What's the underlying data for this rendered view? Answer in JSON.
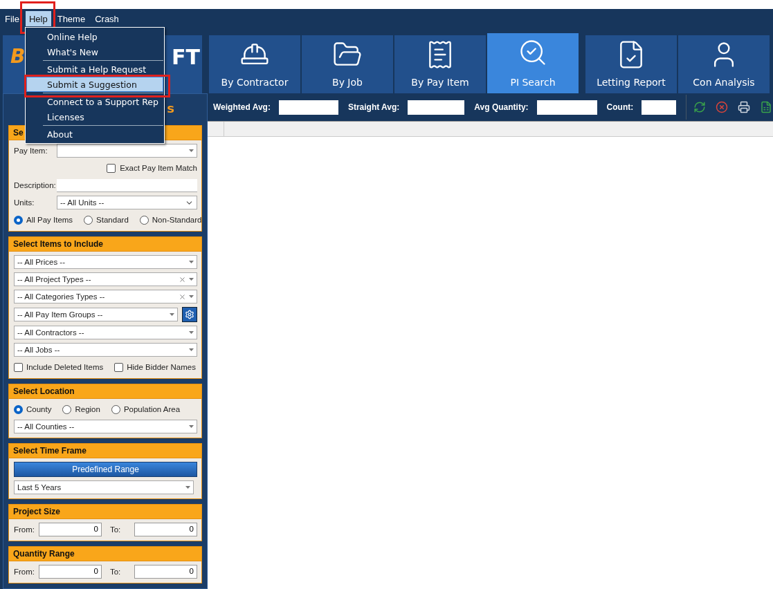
{
  "menubar": [
    {
      "label": "File",
      "open": false,
      "highlighted": false
    },
    {
      "label": "Help",
      "open": true,
      "highlighted": true
    },
    {
      "label": "Theme",
      "open": false,
      "highlighted": false
    },
    {
      "label": "Crash",
      "open": false,
      "highlighted": false
    }
  ],
  "help_menu": [
    {
      "kind": "item",
      "label": "Online Help",
      "selected": false,
      "highlighted": false
    },
    {
      "kind": "item",
      "label": "What's New",
      "selected": false,
      "highlighted": false
    },
    {
      "kind": "separator"
    },
    {
      "kind": "item",
      "label": "Submit a Help Request",
      "selected": false,
      "highlighted": false
    },
    {
      "kind": "item",
      "label": "Submit a Suggestion",
      "selected": true,
      "highlighted": true
    },
    {
      "kind": "separator"
    },
    {
      "kind": "item",
      "label": "Connect to a Support Rep",
      "selected": false,
      "highlighted": false
    },
    {
      "kind": "item",
      "label": "Licenses",
      "selected": false,
      "highlighted": false
    },
    {
      "kind": "separator"
    },
    {
      "kind": "item",
      "label": "About",
      "selected": false,
      "highlighted": false
    }
  ],
  "logo": {
    "left": "B",
    "right": "FT"
  },
  "tabs": [
    {
      "label": "By Contractor",
      "selected": false
    },
    {
      "label": "By Job",
      "selected": false
    },
    {
      "label": "By Pay Item",
      "selected": false
    },
    {
      "label": "PI Search",
      "selected": true
    },
    {
      "label": "Letting Report",
      "selected": false
    },
    {
      "label": "Con Analysis",
      "selected": false
    }
  ],
  "sidebar": {
    "title_fragment": "s",
    "sections": [
      {
        "title": "Se",
        "rows": [
          {
            "kind": "labeled-combo",
            "label": "Pay Item:"
          },
          {
            "kind": "check-right",
            "label": "Exact Pay Item Match",
            "checked": false
          },
          {
            "kind": "labeled-text",
            "label": "Description:"
          },
          {
            "kind": "labeled-select",
            "label": "Units:",
            "value": "-- All Units --"
          },
          {
            "kind": "radios",
            "options": [
              {
                "label": "All Pay Items",
                "selected": true
              },
              {
                "label": "Standard",
                "selected": false
              },
              {
                "label": "Non-Standard",
                "selected": false
              }
            ]
          }
        ]
      },
      {
        "title": "Select Items to Include",
        "rows": [
          {
            "kind": "combo",
            "value": "-- All Prices --",
            "clearable": false
          },
          {
            "kind": "combo",
            "value": "-- All Project Types --",
            "clearable": true
          },
          {
            "kind": "combo",
            "value": "-- All Categories Types --",
            "clearable": true
          },
          {
            "kind": "gear-combo",
            "value": "-- All Pay Item Groups --"
          },
          {
            "kind": "combo",
            "value": "-- All Contractors --",
            "clearable": false
          },
          {
            "kind": "combo",
            "value": "-- All Jobs --",
            "clearable": false
          },
          {
            "kind": "checks",
            "items": [
              {
                "label": "Include Deleted Items",
                "checked": false
              },
              {
                "label": "Hide Bidder Names",
                "checked": false
              }
            ]
          }
        ]
      },
      {
        "title": "Select Location",
        "rows": [
          {
            "kind": "radios",
            "options": [
              {
                "label": "County",
                "selected": true
              },
              {
                "label": "Region",
                "selected": false
              },
              {
                "label": "Population Area",
                "selected": false
              }
            ]
          },
          {
            "kind": "combo",
            "value": "-- All Counties --",
            "clearable": false
          }
        ]
      },
      {
        "title": "Select Time Frame",
        "rows": [
          {
            "kind": "button",
            "label": "Predefined Range"
          },
          {
            "kind": "short-combo",
            "value": "Last 5 Years"
          }
        ]
      },
      {
        "title": "Project Size",
        "rows": [
          {
            "kind": "range",
            "from_label": "From:",
            "from_value": "0",
            "to_label": "To:",
            "to_value": "0"
          }
        ]
      },
      {
        "title": "Quantity Range",
        "rows": [
          {
            "kind": "range",
            "from_label": "From:",
            "from_value": "0",
            "to_label": "To:",
            "to_value": "0"
          }
        ]
      }
    ]
  },
  "stats": [
    {
      "label": "Weighted Avg:"
    },
    {
      "label": "Straight Avg:"
    },
    {
      "label": "Avg Quantity:"
    },
    {
      "label": "Count:"
    }
  ]
}
